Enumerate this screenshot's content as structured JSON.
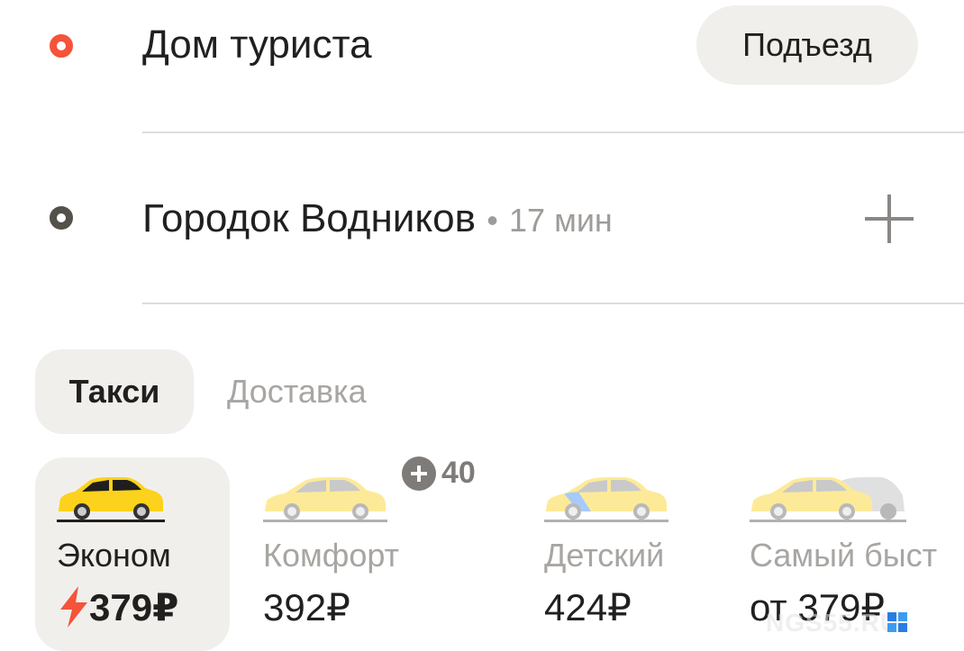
{
  "route": {
    "pickup": {
      "address": "Дом туриста",
      "entrance_button": "Подъезд"
    },
    "destination": {
      "address": "Городок Водников",
      "separator": "•",
      "eta": "17 мин"
    }
  },
  "tabs": [
    {
      "label": "Такси",
      "active": true
    },
    {
      "label": "Доставка",
      "active": false
    }
  ],
  "plus_points": "40",
  "tariffs": [
    {
      "name": "Эконом",
      "price": "379₽",
      "surge": true,
      "selected": true
    },
    {
      "name": "Комфорт",
      "price": "392₽",
      "selected": false
    },
    {
      "name": "Детский",
      "price": "424₽",
      "selected": false
    },
    {
      "name": "Самый быст",
      "price": "от 379₽",
      "selected": false
    }
  ],
  "watermark": "NGS55.RU",
  "colors": {
    "pickup_dot": "#f5533a",
    "dest_dot": "#54504a",
    "car_yellow": "#fcd21c",
    "surge": "#f5533a"
  }
}
